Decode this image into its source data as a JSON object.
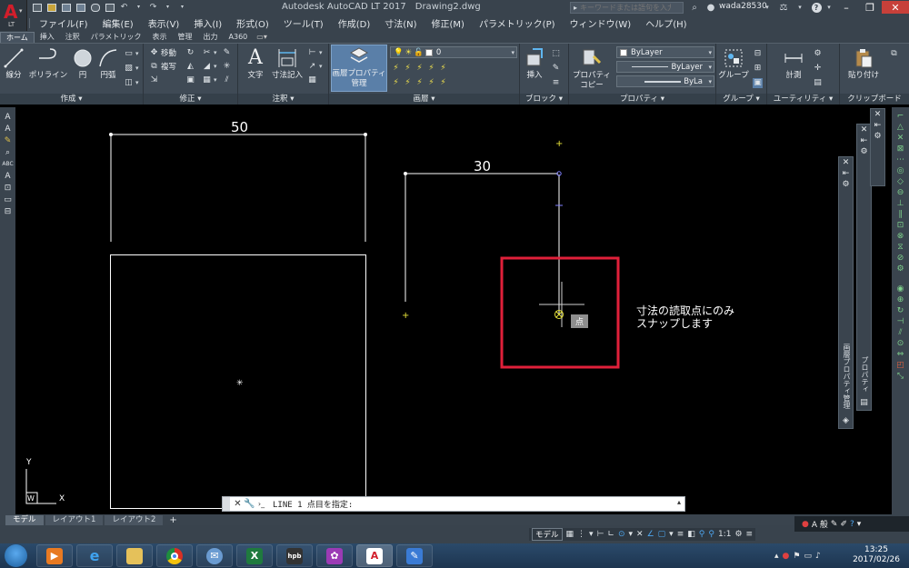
{
  "titlebar": {
    "app_name": "Autodesk AutoCAD LT 2017",
    "document": "Drawing2.dwg",
    "search_placeholder": "キーワードまたは語句を入力",
    "user": "wada28530",
    "logo_letter": "A",
    "logo_sub": "LT"
  },
  "menubar": {
    "items": [
      "ファイル(F)",
      "編集(E)",
      "表示(V)",
      "挿入(I)",
      "形式(O)",
      "ツール(T)",
      "作成(D)",
      "寸法(N)",
      "修正(M)",
      "パラメトリック(P)",
      "ウィンドウ(W)",
      "ヘルプ(H)"
    ]
  },
  "ribbon_tabs": [
    "ホーム",
    "挿入",
    "注釈",
    "パラメトリック",
    "表示",
    "管理",
    "出力",
    "A360"
  ],
  "ribbon": {
    "draw": {
      "title": "作成 ▾",
      "line": "線分",
      "polyline": "ポリライン",
      "circle": "円",
      "arc": "円弧"
    },
    "modify": {
      "title": "修正 ▾",
      "move": "移動",
      "copy": "複写"
    },
    "annotation": {
      "title": "注釈 ▾",
      "text": "文字",
      "dimension": "寸法記入",
      "text_glyph": "A"
    },
    "layers": {
      "title": "画層 ▾",
      "layer_props": "画層プロパティ",
      "layer_props2": "管理",
      "current_layer": "0"
    },
    "block": {
      "title": "ブロック ▾",
      "insert": "挿入"
    },
    "properties": {
      "title": "プロパティ ▾",
      "match": "プロパティ",
      "match2": "コピー",
      "color": "ByLayer",
      "linetype": "ByLayer",
      "lineweight": "ByLa"
    },
    "groups": {
      "title": "グループ ▾",
      "group": "グループ"
    },
    "utilities": {
      "title": "ユーティリティ ▾",
      "measure": "計測"
    },
    "clipboard": {
      "title": "クリップボード",
      "paste": "貼り付け"
    }
  },
  "drawing": {
    "dim_top": "50",
    "dim_right": "30",
    "annotation_line1": "寸法の読取点にのみ",
    "annotation_line2": "スナップします",
    "tooltip": "点",
    "ucs_y": "Y",
    "ucs_w": "W",
    "ucs_x": "X",
    "palette1_label": "プロパティ",
    "palette2_label": "画層プロパティ管理"
  },
  "command": {
    "text": "LINE 1 点目を指定:"
  },
  "layout_tabs": [
    "モデル",
    "レイアウト1",
    "レイアウト2"
  ],
  "status": {
    "model": "モデル",
    "scale": "1:1"
  },
  "notify": {
    "label": "A 般"
  },
  "clock": {
    "time": "13:25",
    "date": "2017/02/26"
  },
  "colors": {
    "annotation_box": "#e0203a",
    "dim_line": "#ffffff",
    "snap_marker": "#e6e23a"
  }
}
